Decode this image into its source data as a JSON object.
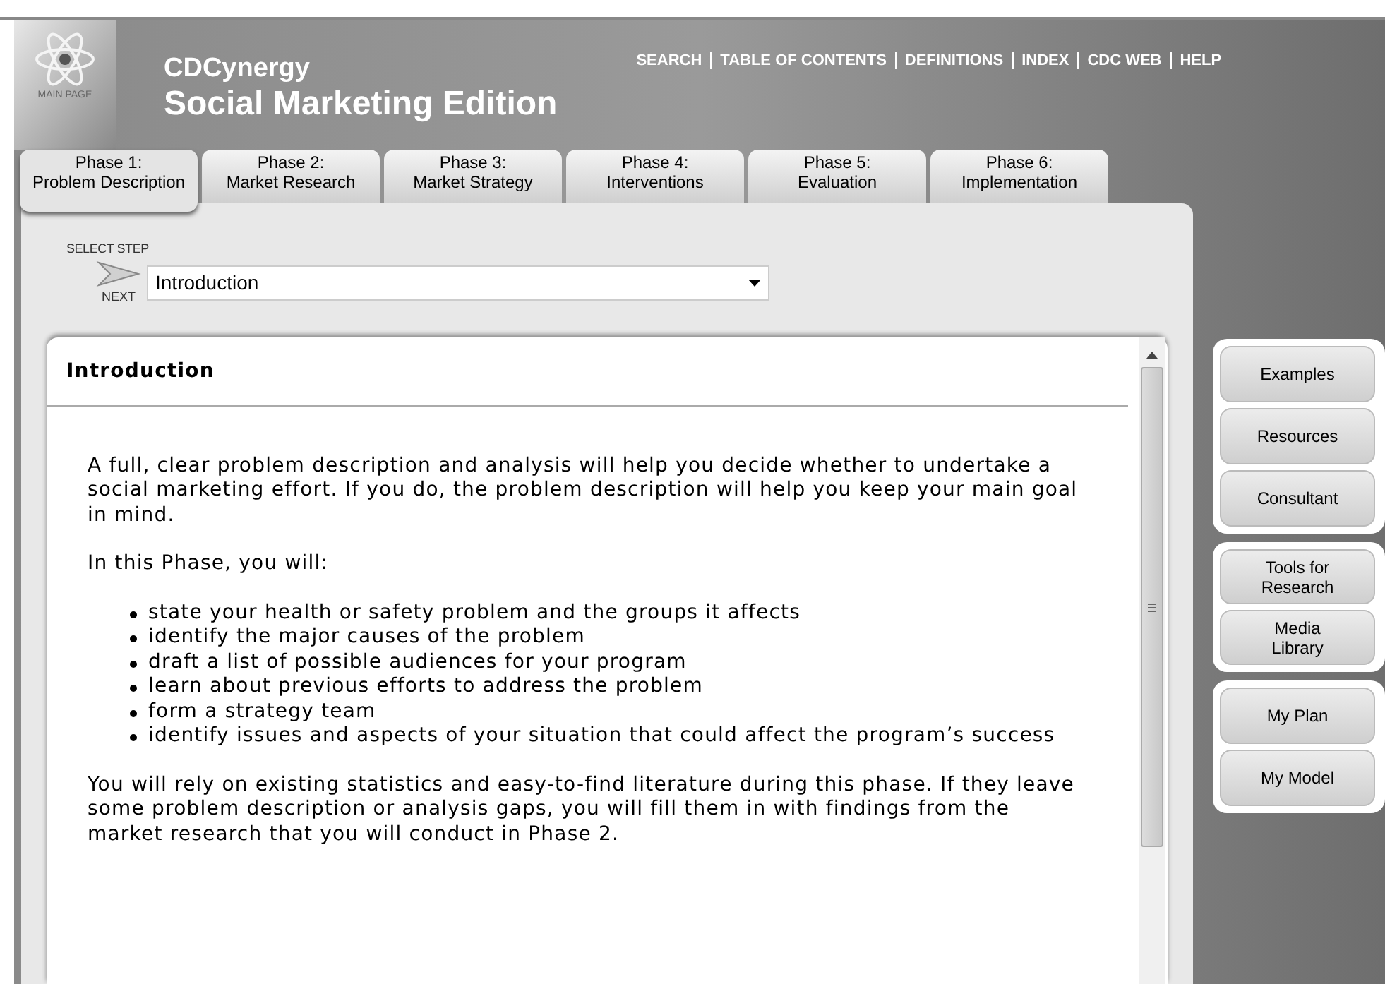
{
  "header": {
    "logo_label": "MAIN PAGE",
    "title": "CDCynergy",
    "subtitle": "Social Marketing Edition",
    "nav": [
      "SEARCH",
      "TABLE OF CONTENTS",
      "DEFINITIONS",
      "INDEX",
      "CDC WEB",
      "HELP"
    ]
  },
  "tabs": [
    {
      "line1": "Phase 1:",
      "line2": "Problem Description",
      "selected": true
    },
    {
      "line1": "Phase 2:",
      "line2": "Market Research",
      "selected": false
    },
    {
      "line1": "Phase 3:",
      "line2": "Market Strategy",
      "selected": false
    },
    {
      "line1": "Phase 4:",
      "line2": "Interventions",
      "selected": false
    },
    {
      "line1": "Phase 5:",
      "line2": "Evaluation",
      "selected": false
    },
    {
      "line1": "Phase 6:",
      "line2": "Implementation",
      "selected": false
    }
  ],
  "step": {
    "label": "SELECT STEP",
    "next": "NEXT",
    "value": "Introduction"
  },
  "content": {
    "heading": "Introduction",
    "blocks": [
      {
        "kind": "paragraph",
        "text": "A full, clear problem description and analysis will help you decide whether to undertake a social marketing effort. If you do, the problem description will help you keep your main goal in mind."
      },
      {
        "kind": "paragraph",
        "text": "In this Phase, you will:"
      },
      {
        "kind": "list",
        "items": [
          "state your health or safety problem and the groups it affects",
          "identify the major causes of the problem",
          "draft a list of possible audiences for your program",
          "learn about previous efforts to address the problem",
          "form a strategy team",
          "identify issues and aspects of your situation that could affect the program’s success"
        ]
      },
      {
        "kind": "paragraph",
        "text": "You will rely on existing statistics and easy-to-find literature during this phase. If they leave some problem description or analysis gaps, you will fill them in with findings from the market research that you will conduct in Phase 2."
      }
    ]
  },
  "sidebar": [
    [
      "Examples",
      "Resources",
      "Consultant"
    ],
    [
      "Tools for Research",
      "Media Library"
    ],
    [
      "My Plan",
      "My Model"
    ]
  ]
}
